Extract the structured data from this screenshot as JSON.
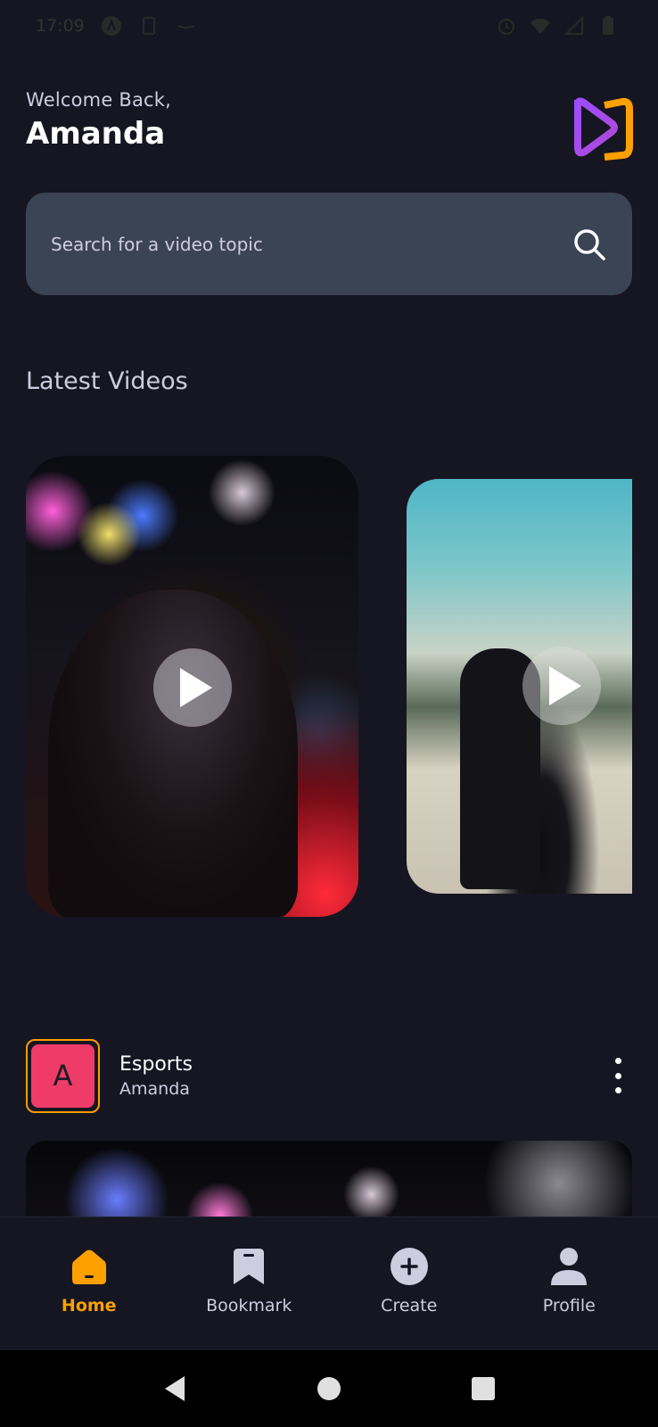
{
  "status_bar": {
    "time": "17:09"
  },
  "header": {
    "welcome": "Welcome Back,",
    "username": "Amanda"
  },
  "search": {
    "placeholder": "Search for a video topic",
    "icon": "search-icon"
  },
  "latest": {
    "title": "Latest Videos",
    "cards": [
      {
        "icon": "play-icon"
      },
      {
        "icon": "play-icon"
      }
    ]
  },
  "post": {
    "avatar_letter": "A",
    "title": "Esports",
    "author": "Amanda",
    "menu_icon": "more-vertical-icon"
  },
  "tabs": [
    {
      "label": "Home",
      "icon": "home-icon",
      "active": true
    },
    {
      "label": "Bookmark",
      "icon": "bookmark-icon",
      "active": false
    },
    {
      "label": "Create",
      "icon": "plus-circle-icon",
      "active": false
    },
    {
      "label": "Profile",
      "icon": "user-icon",
      "active": false
    }
  ],
  "colors": {
    "background": "#161622",
    "accent": "#FFA001",
    "search_bg": "#3B4455",
    "text_muted": "#CDCDE0",
    "avatar_bg": "#ee3b67"
  }
}
